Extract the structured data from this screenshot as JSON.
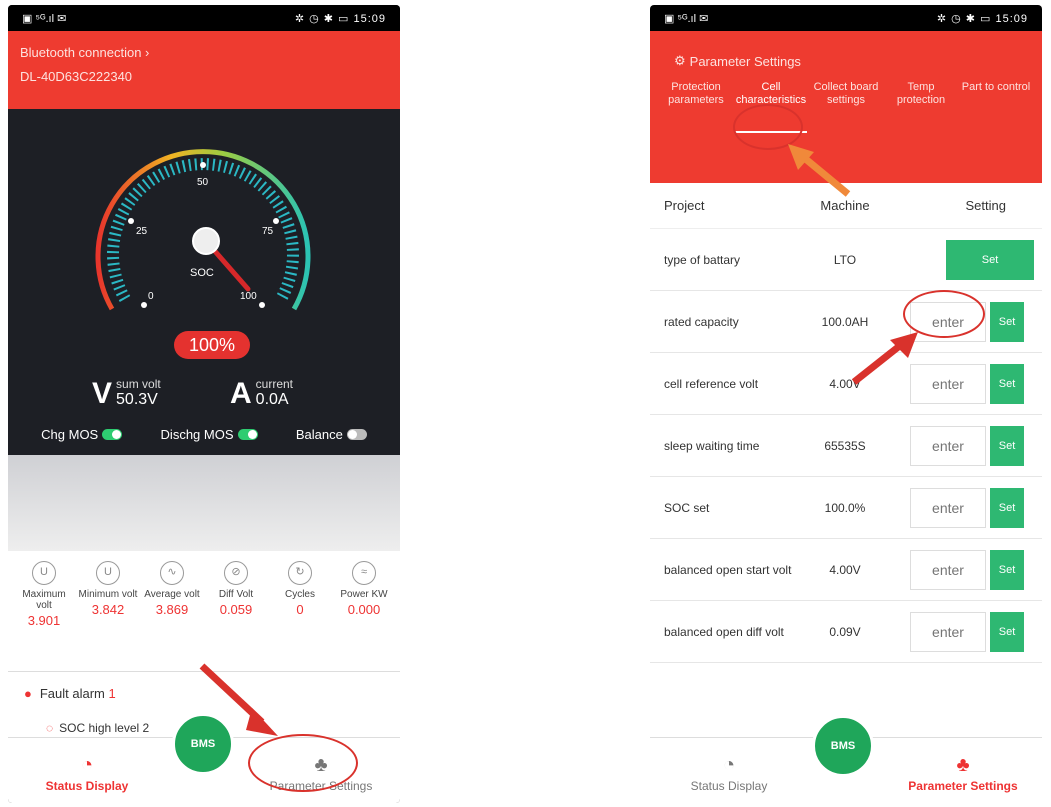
{
  "left": {
    "status": {
      "left": "▣ ⁵ᴳ.ıl ✉",
      "right": "✲ ◷ ✱ ▭ 15:09"
    },
    "header": {
      "line1": "Bluetooth connection ›",
      "line2": "DL-40D63C222340"
    },
    "gauge": {
      "center_label": "SOC",
      "ticks": [
        "0",
        "25",
        "50",
        "75",
        "100"
      ],
      "soc": "100%",
      "soc_value": 100
    },
    "meters": {
      "volt": {
        "symbol": "V",
        "label": "sum volt",
        "value": "50.3V"
      },
      "current": {
        "symbol": "A",
        "label": "current",
        "value": "0.0A"
      }
    },
    "mos": {
      "chg": "Chg MOS",
      "dischg": "Dischg MOS",
      "balance": "Balance"
    },
    "stats": [
      {
        "label": "Maximum volt",
        "value": "3.901",
        "icon": "U"
      },
      {
        "label": "Minimum volt",
        "value": "3.842",
        "icon": "U"
      },
      {
        "label": "Average volt",
        "value": "3.869",
        "icon": "∿"
      },
      {
        "label": "Diff Volt",
        "value": "0.059",
        "icon": "⊘"
      },
      {
        "label": "Cycles",
        "value": "0",
        "icon": "↻"
      },
      {
        "label": "Power KW",
        "value": "0.000",
        "icon": "≈"
      }
    ],
    "faults": {
      "title": "Fault alarm",
      "count": "1",
      "item": "SOC high level 2"
    },
    "nav": {
      "status": "Status Display",
      "params": "Parameter Settings",
      "logo": "BMS"
    }
  },
  "right": {
    "status": {
      "left": "▣ ⁵ᴳ.ıl ✉",
      "right": "✲ ◷ ✱ ▭ 15:09"
    },
    "title": "Parameter Settings",
    "tabs": [
      "Protection parameters",
      "Cell characteristics",
      "Collect board settings",
      "Temp protection",
      "Part to control"
    ],
    "table_head": {
      "project": "Project",
      "machine": "Machine",
      "setting": "Setting"
    },
    "rows": [
      {
        "project": "type of battary",
        "machine": "LTO"
      },
      {
        "project": "rated capacity",
        "machine": "100.0AH",
        "placeholder": "enter"
      },
      {
        "project": "cell reference volt",
        "machine": "4.00V",
        "placeholder": "enter"
      },
      {
        "project": "sleep waiting time",
        "machine": "65535S",
        "placeholder": "enter"
      },
      {
        "project": "SOC set",
        "machine": "100.0%",
        "placeholder": "enter"
      },
      {
        "project": "balanced open start volt",
        "machine": "4.00V",
        "placeholder": "enter"
      },
      {
        "project": "balanced open diff volt",
        "machine": "0.09V",
        "placeholder": "enter"
      }
    ],
    "set_label": "Set",
    "nav": {
      "status": "Status Display",
      "params": "Parameter Settings",
      "logo": "BMS"
    }
  },
  "colors": {
    "brand_red": "#ee3b30",
    "set_green": "#2eb872",
    "dash_bg": "#1d1f25",
    "annotation": "#d9322c"
  }
}
